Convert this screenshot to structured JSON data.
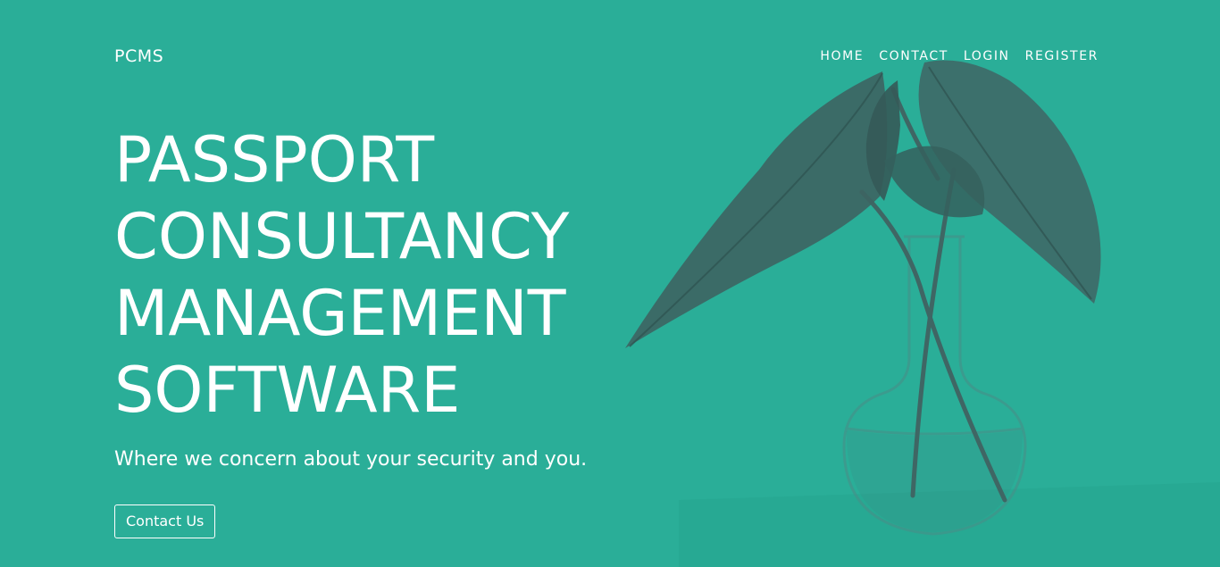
{
  "navbar": {
    "brand": "PCMS",
    "links": [
      {
        "label": "HOME"
      },
      {
        "label": "CONTACT"
      },
      {
        "label": "LOGIN"
      },
      {
        "label": "REGISTER"
      }
    ]
  },
  "hero": {
    "headline_lines": [
      "PASSPORT",
      "CONSULTANCY",
      "MANAGEMENT",
      "SOFTWARE"
    ],
    "tagline": "Where we concern about your security and you.",
    "cta_label": "Contact Us"
  },
  "colors": {
    "background": "#2aae98",
    "overlay_dark": "#3a6f6a",
    "text": "#ffffff"
  },
  "background_image": "plant-in-glass-vase"
}
